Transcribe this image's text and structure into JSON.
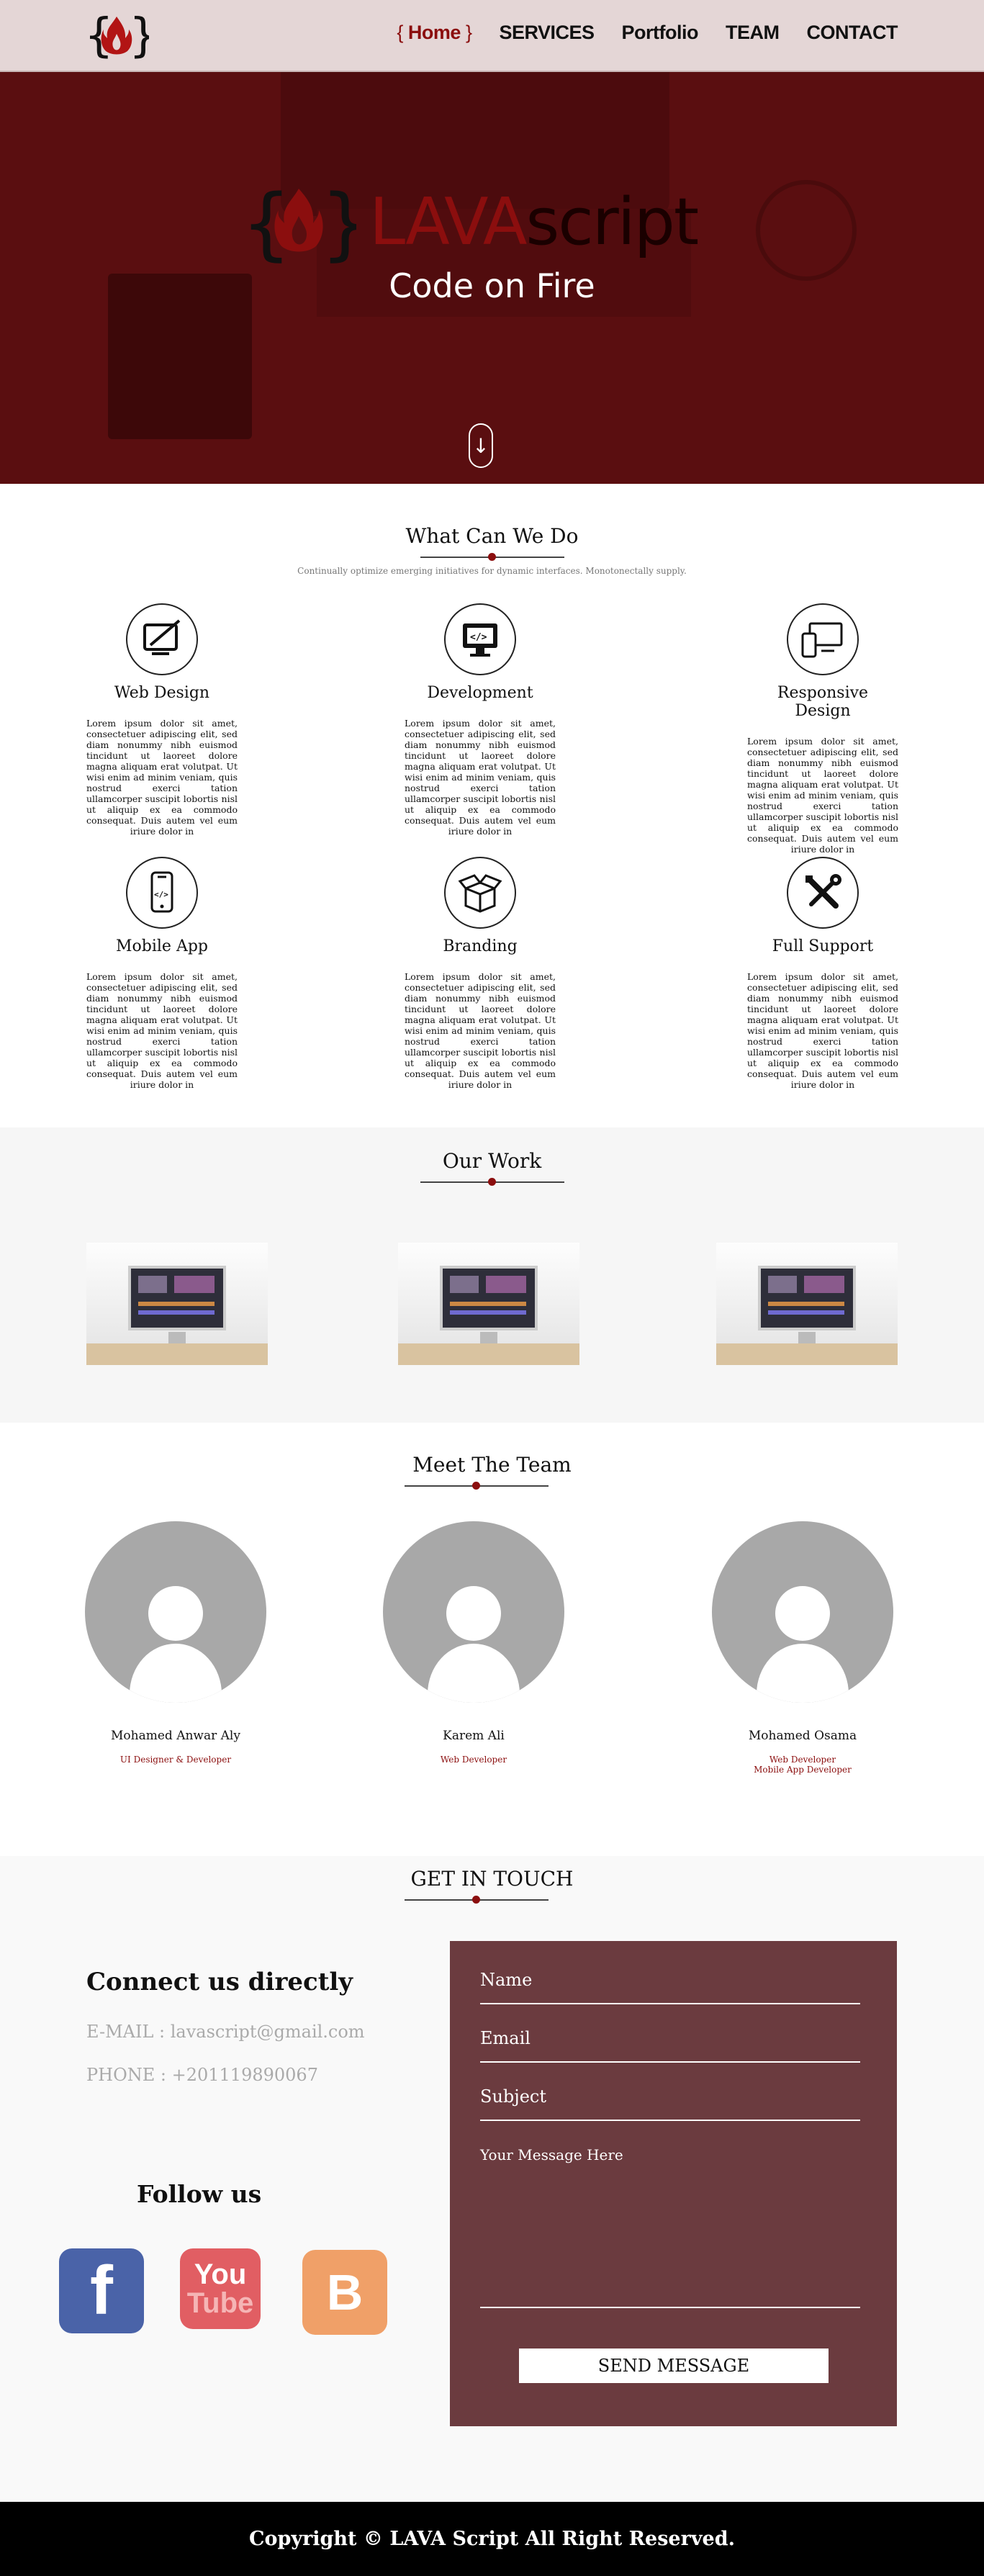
{
  "nav": {
    "brace_open": "{",
    "brace_close": "}",
    "items": [
      {
        "label": "Home"
      },
      {
        "label": "SERVICES"
      },
      {
        "label": "Portfolio"
      },
      {
        "label": "TEAM"
      },
      {
        "label": "CONTACT"
      }
    ],
    "active": "Home",
    "logo_icon": "flame-braces-logo"
  },
  "hero": {
    "logo_word1": "LAVA",
    "logo_word2": "script",
    "tagline": "Code on Fire",
    "scroll_icon": "arrow-down-icon"
  },
  "services": {
    "title": "What Can We Do",
    "subtitle": "Continually optimize emerging initiatives for dynamic interfaces. Monotonectally supply.",
    "items": [
      {
        "title": "Web Design",
        "icon": "design-tablet-icon",
        "text": "Lorem ipsum dolor sit amet, consectetuer adipiscing elit, sed diam nonummy nibh euismod tincidunt ut laoreet dolore magna aliquam erat volutpat. Ut wisi enim ad minim veniam, quis nostrud exerci tation ullamcorper suscipit lobortis nisl ut aliquip ex ea commodo consequat. Duis autem vel eum iriure dolor in"
      },
      {
        "title": "Development",
        "icon": "code-monitor-icon",
        "text": "Lorem ipsum dolor sit amet, consectetuer adipiscing elit, sed diam nonummy nibh euismod tincidunt ut laoreet dolore magna aliquam erat volutpat. Ut wisi enim ad minim veniam, quis nostrud exerci tation ullamcorper suscipit lobortis nisl ut aliquip ex ea commodo consequat. Duis autem vel eum iriure dolor in"
      },
      {
        "title": "Responsive Design",
        "icon": "devices-icon",
        "text": "Lorem ipsum dolor sit amet, consectetuer adipiscing elit, sed diam nonummy nibh euismod tincidunt ut laoreet dolore magna aliquam erat volutpat. Ut wisi enim ad minim veniam, quis nostrud exerci tation ullamcorper suscipit lobortis nisl ut aliquip ex ea commodo consequat. Duis autem vel eum iriure dolor in"
      },
      {
        "title": "Mobile App",
        "icon": "mobile-code-icon",
        "text": "Lorem ipsum dolor sit amet, consectetuer adipiscing elit, sed diam nonummy nibh euismod tincidunt ut laoreet dolore magna aliquam erat volutpat. Ut wisi enim ad minim veniam, quis nostrud exerci tation ullamcorper suscipit lobortis nisl ut aliquip ex ea commodo consequat. Duis autem vel eum iriure dolor in"
      },
      {
        "title": "Branding",
        "icon": "open-box-icon",
        "text": "Lorem ipsum dolor sit amet, consectetuer adipiscing elit, sed diam nonummy nibh euismod tincidunt ut laoreet dolore magna aliquam erat volutpat. Ut wisi enim ad minim veniam, quis nostrud exerci tation ullamcorper suscipit lobortis nisl ut aliquip ex ea commodo consequat. Duis autem vel eum iriure dolor in"
      },
      {
        "title": "Full Support",
        "icon": "tools-icon",
        "text": "Lorem ipsum dolor sit amet, consectetuer adipiscing elit, sed diam nonummy nibh euismod tincidunt ut laoreet dolore magna aliquam erat volutpat. Ut wisi enim ad minim veniam, quis nostrud exerci tation ullamcorper suscipit lobortis nisl ut aliquip ex ea commodo consequat. Duis autem vel eum iriure dolor in"
      }
    ]
  },
  "work": {
    "title": "Our Work",
    "thumbnails": [
      "monitor-photo",
      "monitor-photo",
      "monitor-photo"
    ]
  },
  "team": {
    "title": "Meet The Team",
    "members": [
      {
        "name": "Mohamed Anwar Aly",
        "role": "UI Designer & Developer",
        "role2": ""
      },
      {
        "name": "Karem Ali",
        "role": "Web Developer",
        "role2": ""
      },
      {
        "name": "Mohamed Osama",
        "role": "Web Developer",
        "role2": "Mobile App Developer"
      }
    ]
  },
  "contact": {
    "title": "GET IN TOUCH",
    "connect_heading": "Connect us directly",
    "email_line": "E-MAIL : lavascript@gmail.com",
    "phone_line": "PHONE : +201119890067",
    "follow_heading": "Follow us",
    "social": [
      {
        "name": "facebook",
        "glyph": "f",
        "color": "#4a63a8"
      },
      {
        "name": "youtube",
        "glyph1": "You",
        "glyph2": "Tube",
        "color": "#e15e63"
      },
      {
        "name": "blogger",
        "glyph": "B",
        "color": "#f0a068"
      }
    ],
    "form": {
      "name_placeholder": "Name",
      "email_placeholder": "Email",
      "subject_placeholder": "Subject",
      "message_placeholder": "Your Message Here",
      "send_label": "SEND MESSAGE"
    }
  },
  "footer": {
    "text": "Copyright © LAVA Script All Right Reserved."
  },
  "colors": {
    "brand": "#8b0e0e",
    "hero": "#5a0e10",
    "nav_bg": "#e4d6d6",
    "form_bg": "#6b3b3f"
  }
}
